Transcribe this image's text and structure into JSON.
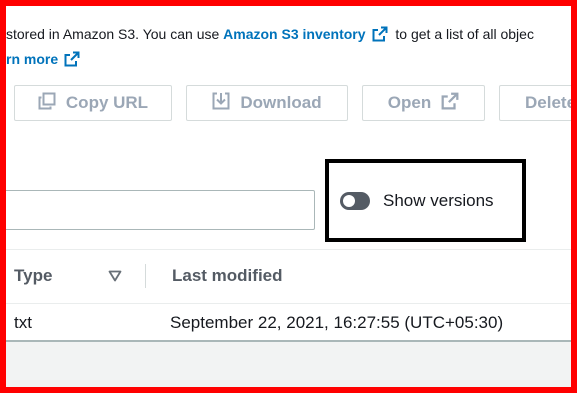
{
  "description": {
    "line1_prefix": "stored in Amazon S3. You can use ",
    "line1_link": "Amazon S3 inventory",
    "line1_suffix": " to get a list of all objec",
    "line2_link": "rn more"
  },
  "toolbar": {
    "copy_url_label": "Copy URL",
    "download_label": "Download",
    "open_label": "Open",
    "delete_label": "Delete"
  },
  "search": {
    "value": "",
    "placeholder": ""
  },
  "versions_toggle": {
    "label": "Show versions",
    "enabled": false
  },
  "table": {
    "columns": {
      "type": "Type",
      "last_modified": "Last modified"
    },
    "rows": [
      {
        "type": "txt",
        "last_modified": "September 22, 2021, 16:27:55 (UTC+05:30)"
      }
    ]
  },
  "colors": {
    "link": "#0073bb",
    "disabled_text": "#9ba7b6",
    "annotation_red": "#ff0000",
    "highlight_box": "#000000"
  },
  "icons": {
    "external_link": "external-link-icon",
    "copy": "copy-icon",
    "download": "download-icon",
    "sort": "sort-down-icon"
  }
}
